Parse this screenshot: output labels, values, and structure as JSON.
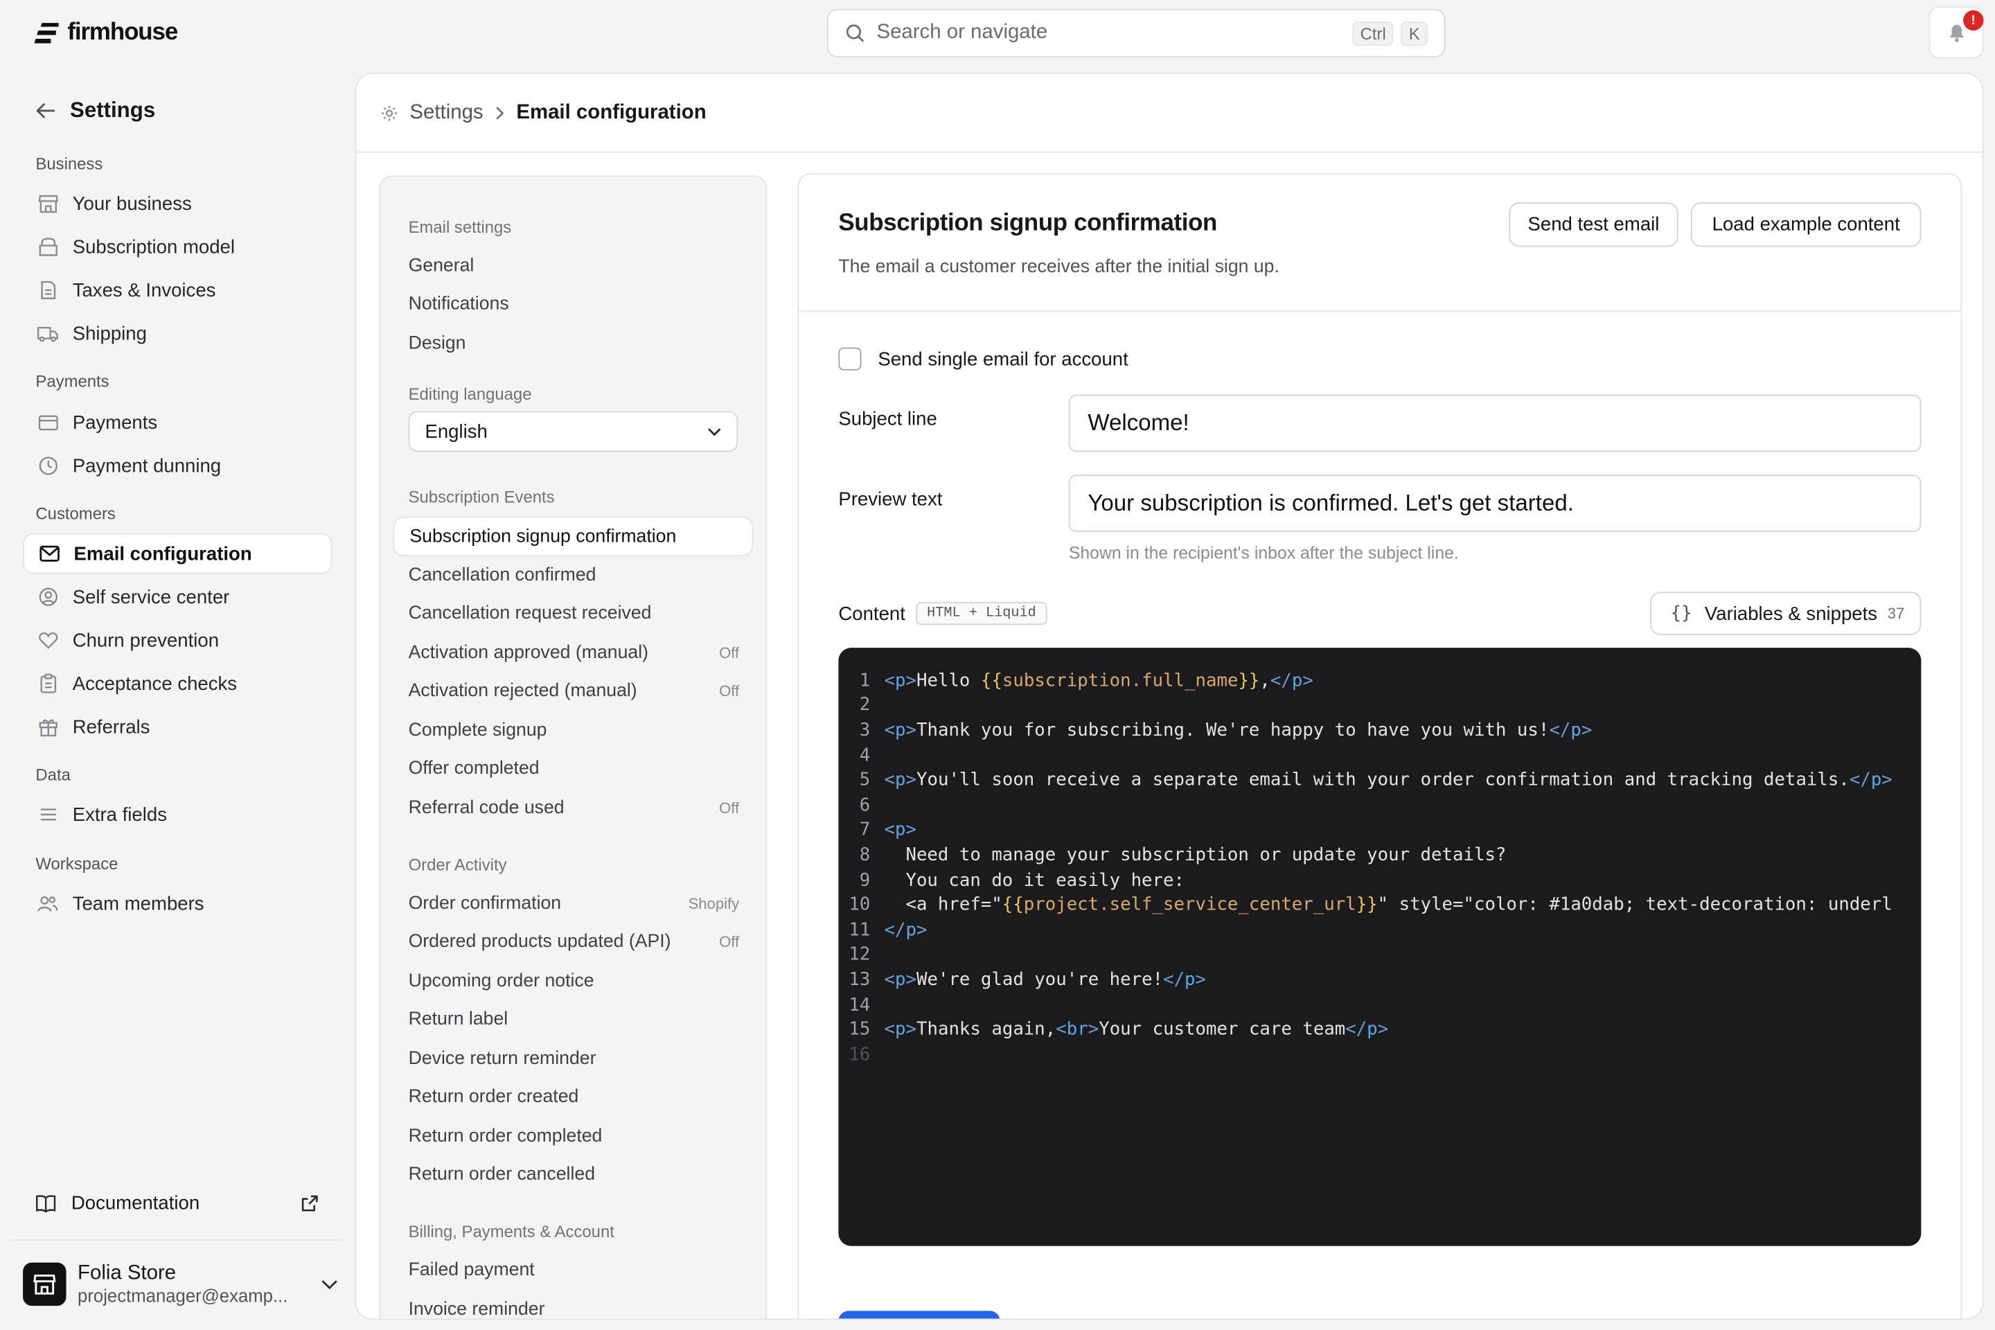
{
  "app": {
    "brand": "firmhouse"
  },
  "search": {
    "placeholder": "Search or navigate",
    "kbd1": "Ctrl",
    "kbd2": "K"
  },
  "notifications": {
    "badge": "!"
  },
  "sidebar": {
    "back_label": "Settings",
    "groups": [
      {
        "label": "Business",
        "items": [
          {
            "label": "Your business",
            "icon": "store-icon"
          },
          {
            "label": "Subscription model",
            "icon": "box-icon"
          },
          {
            "label": "Taxes & Invoices",
            "icon": "document-icon"
          },
          {
            "label": "Shipping",
            "icon": "truck-icon"
          }
        ]
      },
      {
        "label": "Payments",
        "items": [
          {
            "label": "Payments",
            "icon": "credit-card-icon"
          },
          {
            "label": "Payment dunning",
            "icon": "clock-icon"
          }
        ]
      },
      {
        "label": "Customers",
        "items": [
          {
            "label": "Email configuration",
            "icon": "mail-icon",
            "active": true
          },
          {
            "label": "Self service center",
            "icon": "user-circle-icon"
          },
          {
            "label": "Churn prevention",
            "icon": "heart-icon"
          },
          {
            "label": "Acceptance checks",
            "icon": "clipboard-icon"
          },
          {
            "label": "Referrals",
            "icon": "gift-icon"
          }
        ]
      },
      {
        "label": "Data",
        "items": [
          {
            "label": "Extra fields",
            "icon": "list-icon"
          }
        ]
      },
      {
        "label": "Workspace",
        "items": [
          {
            "label": "Team members",
            "icon": "users-icon"
          }
        ]
      }
    ],
    "documentation": "Documentation",
    "account": {
      "name": "Folia Store",
      "email": "projectmanager@examp..."
    }
  },
  "breadcrumb": {
    "root": "Settings",
    "current": "Email configuration"
  },
  "email_menu": {
    "groups": [
      {
        "label": "Email settings",
        "items": [
          {
            "label": "General",
            "tag": ""
          },
          {
            "label": "Notifications",
            "tag": ""
          },
          {
            "label": "Design",
            "tag": ""
          }
        ]
      },
      {
        "label": "Editing language",
        "select": "English"
      },
      {
        "label": "Subscription Events",
        "items": [
          {
            "label": "Subscription signup confirmation",
            "tag": "",
            "active": true
          },
          {
            "label": "Cancellation confirmed",
            "tag": ""
          },
          {
            "label": "Cancellation request received",
            "tag": ""
          },
          {
            "label": "Activation approved (manual)",
            "tag": "Off"
          },
          {
            "label": "Activation rejected (manual)",
            "tag": "Off"
          },
          {
            "label": "Complete signup",
            "tag": ""
          },
          {
            "label": "Offer completed",
            "tag": ""
          },
          {
            "label": "Referral code used",
            "tag": "Off"
          }
        ]
      },
      {
        "label": "Order Activity",
        "items": [
          {
            "label": "Order confirmation",
            "tag": "Shopify"
          },
          {
            "label": "Ordered products updated (API)",
            "tag": "Off"
          },
          {
            "label": "Upcoming order notice",
            "tag": ""
          },
          {
            "label": "Return label",
            "tag": ""
          },
          {
            "label": "Device return reminder",
            "tag": ""
          },
          {
            "label": "Return order created",
            "tag": ""
          },
          {
            "label": "Return order completed",
            "tag": ""
          },
          {
            "label": "Return order cancelled",
            "tag": ""
          }
        ]
      },
      {
        "label": "Billing, Payments & Account",
        "items": [
          {
            "label": "Failed payment",
            "tag": ""
          },
          {
            "label": "Invoice reminder",
            "tag": ""
          }
        ]
      }
    ]
  },
  "editor": {
    "title": "Subscription signup confirmation",
    "subtitle": "The email a customer receives after the initial sign up.",
    "send_test": "Send test email",
    "load_example": "Load example content",
    "single_email_label": "Send single email for account",
    "single_email_checked": false,
    "subject_label": "Subject line",
    "subject_value": "Welcome!",
    "preview_label": "Preview text",
    "preview_value": "Your subscription is confirmed. Let's get started.",
    "preview_hint": "Shown in the recipient's inbox after the subject line.",
    "content_label": "Content",
    "content_badge": "HTML + Liquid",
    "variables_label": "Variables & snippets",
    "variables_count": "37",
    "code_lines": [
      "<p>Hello {{subscription.full_name}},</p>",
      "",
      "<p>Thank you for subscribing. We're happy to have you with us!</p>",
      "",
      "<p>You'll soon receive a separate email with your order confirmation and tracking details.</p>",
      "",
      "<p>",
      "  Need to manage your subscription or update your details?",
      "  You can do it easily here:",
      "  <a href=\"{{project.self_service_center_url}}\" style=\"color: #1a0dab; text-decoration: underl",
      "</p>",
      "",
      "<p>We're glad you're here!</p>",
      "",
      "<p>Thanks again,<br>Your customer care team</p>",
      ""
    ]
  },
  "colors": {
    "brand_blue": "#2563eb",
    "notify": "#dc2626",
    "code_bg": "#1b1b1d"
  }
}
